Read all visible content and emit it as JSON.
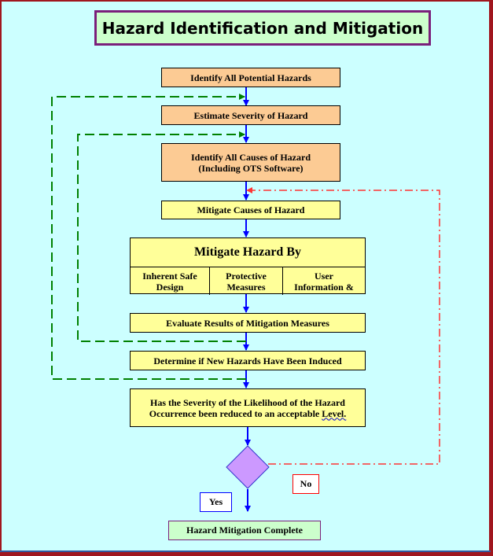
{
  "title": "Hazard Identification and Mitigation",
  "steps": [
    {
      "id": "identify-hazards",
      "label": "Identify All Potential Hazards"
    },
    {
      "id": "estimate-severity",
      "label": "Estimate Severity of Hazard"
    },
    {
      "id": "identify-causes",
      "label_line1": "Identify All Causes of Hazard",
      "label_line2": "(Including OTS Software)"
    },
    {
      "id": "mitigate-causes",
      "label": "Mitigate Causes of Hazard"
    },
    {
      "id": "mitigate-by",
      "label": "Mitigate Hazard By",
      "options": [
        {
          "line1": "Inherent Safe",
          "line2": "Design"
        },
        {
          "line1": "Protective",
          "line2": "Measures"
        },
        {
          "line1": "User",
          "line2": "Information &"
        }
      ]
    },
    {
      "id": "evaluate-results",
      "label": "Evaluate Results of Mitigation Measures"
    },
    {
      "id": "determine-new",
      "label": "Determine if New Hazards Have Been Induced"
    },
    {
      "id": "check-acceptable",
      "label_line1": "Has the Severity of the Likelihood of the Hazard",
      "label_line2_pre": "Occurrence been reduced to an acceptable ",
      "label_line2_word": "Level."
    }
  ],
  "decision": {
    "yes_label": "Yes",
    "no_label": "No"
  },
  "final": {
    "label": "Hazard Mitigation Complete"
  },
  "colors": {
    "background": "#ccffff",
    "frame": "#a0161e",
    "title_border": "#7a1f7a",
    "title_fill": "#ccffcc",
    "orange_fill": "#fccb94",
    "yellow_fill": "#ffff99",
    "flow_arrow": "#0000ff",
    "feedback_green": "#008000",
    "feedback_red": "#ff3333",
    "diamond_fill": "#cc99ff"
  }
}
